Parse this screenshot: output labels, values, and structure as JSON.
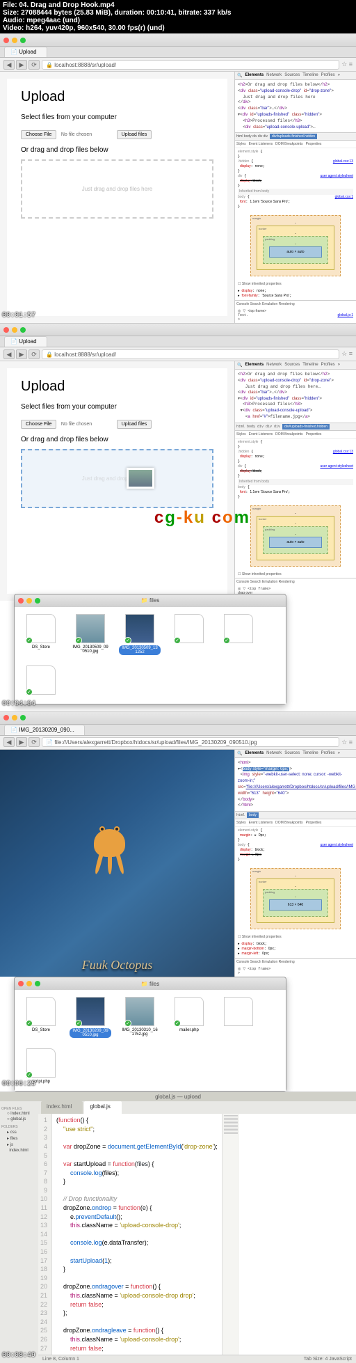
{
  "media_info": {
    "file": "File: 04. Drag and Drop Hook.mp4",
    "size": "Size: 27088444 bytes (25.83 MiB), duration: 00:10:41, bitrate: 337 kb/s",
    "audio": "Audio: mpeg4aac (und)",
    "video": "Video: h264, yuv420p, 960x540, 30.00 fps(r) (und)"
  },
  "section1": {
    "timestamp": "00:01:57",
    "tab_title": "Upload",
    "url": "localhost:8888/sr/upload/",
    "page_title": "Upload",
    "select_label": "Select files from your computer",
    "choose_btn": "Choose File",
    "no_file": "No file chosen",
    "upload_btn": "Upload files",
    "drop_label": "Or drag and drop files below",
    "drop_hint": "Just drag and drop files here",
    "dt_breadcrumb": "html body div div div",
    "dt_bc_sel": "div#uploads-finished.hidden",
    "bm_content": "auto × auto",
    "console_top": "<top frame>",
    "console_link": "global.js:1"
  },
  "section2": {
    "timestamp": "00:04:04",
    "tab_title": "Upload",
    "url": "localhost:8888/sr/upload/",
    "page_title": "Upload",
    "select_label": "Select files from your computer",
    "choose_btn": "Choose File",
    "no_file": "No file chosen",
    "upload_btn": "Upload files",
    "drop_label": "Or drag and drop files below",
    "drop_hint": "Just drag and drop files here",
    "finder_title": "files",
    "files": [
      "DS_Store",
      "IMG_20130509_09 0510.jpg",
      "IMG_20130509_13 1252",
      "...",
      "...",
      "..."
    ],
    "bm_content": "auto × auto",
    "drag_over": "drag over"
  },
  "section3": {
    "timestamp": "00:06:25",
    "tab_title": "IMG_20130209_090...",
    "url": "file:///Users/alexgarrett/Dropbox/htdocs/sr/upload/files/IMG_20130209_090510.jpg",
    "finder_title": "files",
    "files": [
      "DS_Store",
      "IMG_20130209_09 0510.jpg",
      "IMG_20130310_16 1752.jpg",
      "mailer.php",
      "",
      "script.php"
    ],
    "img_caption": "Fuuk Octopus",
    "bm_content": "613 × 640"
  },
  "section4": {
    "timestamp": "00:08:49",
    "editor_title": "global.js — upload",
    "tabs": [
      "index.html",
      "global.js"
    ],
    "sidebar_open": "OPEN FILES",
    "sidebar_folders": "FOLDERS",
    "sidebar_items": [
      "index.html",
      "global.js",
      "css",
      "files",
      "js",
      "index.html"
    ],
    "status_left": "Line 8, Column 1",
    "status_right": "Tab Size: 4    JavaScript"
  },
  "watermark": "www.cg-ku.com",
  "devtools": {
    "tabs": [
      "Elements",
      "Network",
      "Sources",
      "Timeline",
      "Profiles"
    ],
    "style_tabs": [
      "Styles",
      "Event Listeners",
      "DOM Breakpoints",
      "Properties"
    ],
    "console_tabs": [
      "Console",
      "Search",
      "Emulation",
      "Rendering"
    ],
    "show_inherited": "Show inherited properties"
  }
}
